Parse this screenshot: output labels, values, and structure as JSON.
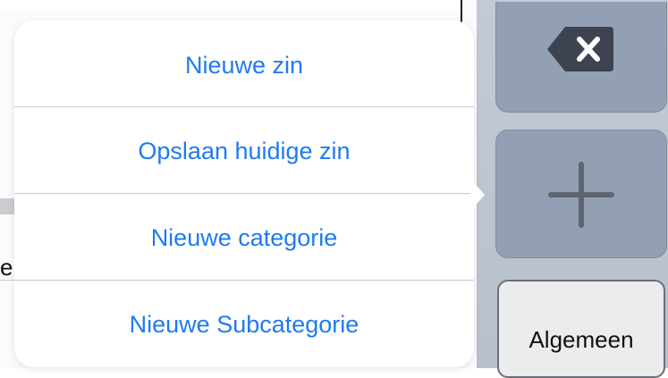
{
  "menu": {
    "items": [
      {
        "label": "Nieuwe zin"
      },
      {
        "label": "Opslaan huidige zin"
      },
      {
        "label": "Nieuwe categorie"
      },
      {
        "label": "Nieuwe Subcategorie"
      }
    ]
  },
  "keyboard": {
    "category_key_label": "Algemeen",
    "delete_icon": "delete-backspace-icon",
    "add_icon": "plus-icon"
  },
  "background": {
    "partial_text": "e"
  },
  "colors": {
    "accent": "#1f7bf0",
    "key_fill": "#93a0b3",
    "panel_bg": "#c2cad5"
  }
}
